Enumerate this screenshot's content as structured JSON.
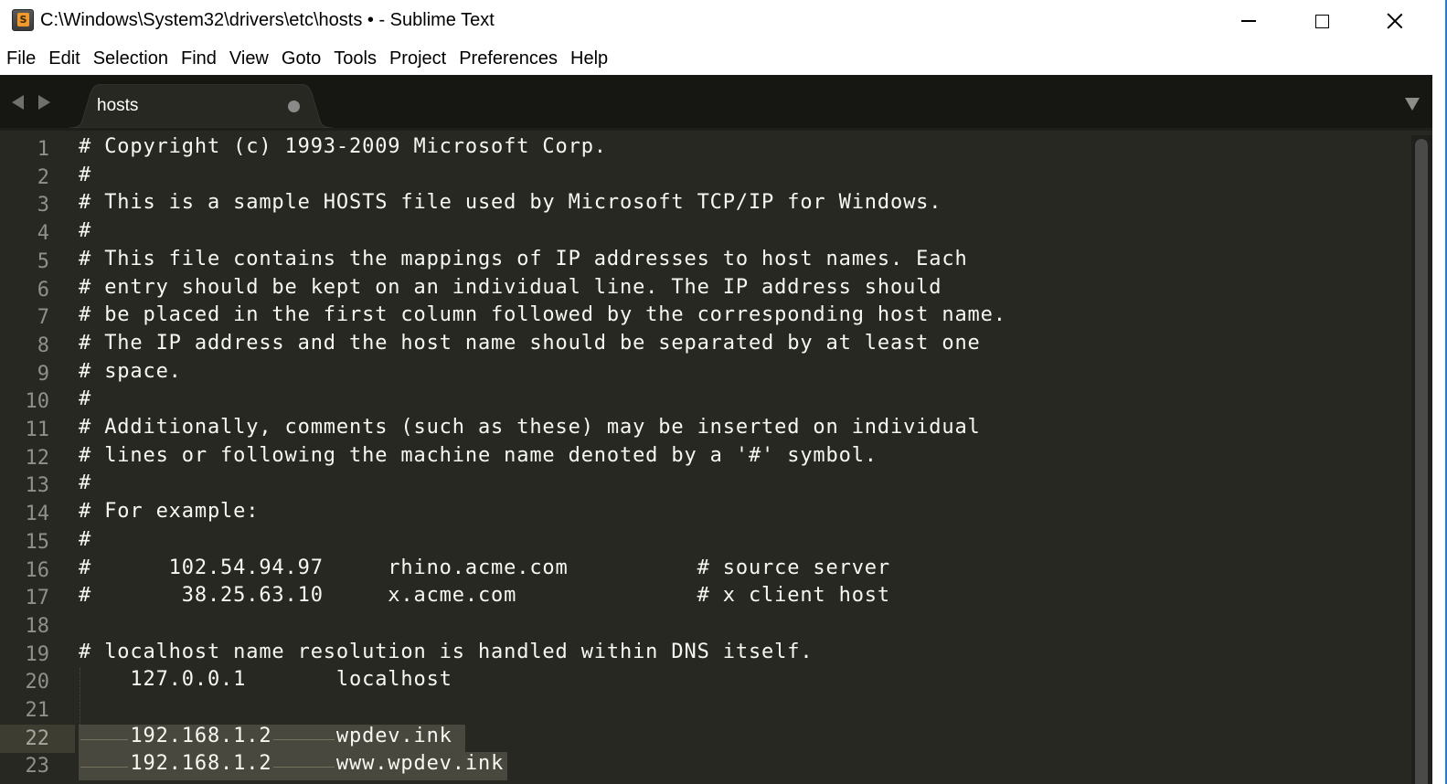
{
  "window": {
    "title": "C:\\Windows\\System32\\drivers\\etc\\hosts • - Sublime Text",
    "app_icon": "sublime-text-icon",
    "controls": [
      "minimize",
      "maximize",
      "close"
    ]
  },
  "menu": [
    "File",
    "Edit",
    "Selection",
    "Find",
    "View",
    "Goto",
    "Tools",
    "Project",
    "Preferences",
    "Help"
  ],
  "tabs": [
    {
      "label": "hosts",
      "dirty": true,
      "active": true
    }
  ],
  "editor": {
    "current_line": 22,
    "selected_lines": [
      22,
      23
    ],
    "lines": [
      {
        "n": "1",
        "text": "# Copyright (c) 1993-2009 Microsoft Corp."
      },
      {
        "n": "2",
        "text": "#"
      },
      {
        "n": "3",
        "text": "# This is a sample HOSTS file used by Microsoft TCP/IP for Windows."
      },
      {
        "n": "4",
        "text": "#"
      },
      {
        "n": "5",
        "text": "# This file contains the mappings of IP addresses to host names. Each"
      },
      {
        "n": "6",
        "text": "# entry should be kept on an individual line. The IP address should"
      },
      {
        "n": "7",
        "text": "# be placed in the first column followed by the corresponding host name."
      },
      {
        "n": "8",
        "text": "# The IP address and the host name should be separated by at least one"
      },
      {
        "n": "9",
        "text": "# space."
      },
      {
        "n": "10",
        "text": "#"
      },
      {
        "n": "11",
        "text": "# Additionally, comments (such as these) may be inserted on individual"
      },
      {
        "n": "12",
        "text": "# lines or following the machine name denoted by a '#' symbol."
      },
      {
        "n": "13",
        "text": "#"
      },
      {
        "n": "14",
        "text": "# For example:"
      },
      {
        "n": "15",
        "text": "#"
      },
      {
        "n": "16",
        "text": "#      102.54.94.97     rhino.acme.com          # source server"
      },
      {
        "n": "17",
        "text": "#       38.25.63.10     x.acme.com              # x client host"
      },
      {
        "n": "18",
        "text": ""
      },
      {
        "n": "19",
        "text": "# localhost name resolution is handled within DNS itself."
      },
      {
        "n": "20",
        "text": "    127.0.0.1       localhost"
      },
      {
        "n": "21",
        "text": ""
      },
      {
        "n": "22",
        "text": "",
        "segments": [
          "    ",
          "192.168.1.2",
          "     ",
          "wpdev.ink"
        ]
      },
      {
        "n": "23",
        "text": "",
        "segments": [
          "    ",
          "192.168.1.2",
          "     ",
          "www.wpdev.ink"
        ]
      }
    ]
  }
}
